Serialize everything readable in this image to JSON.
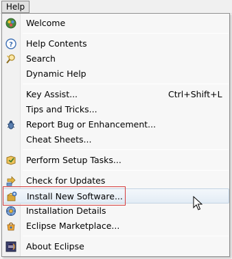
{
  "menubar": {
    "help_label": "Help"
  },
  "menu": {
    "items": [
      {
        "label": "Welcome",
        "icon": "welcome-icon"
      },
      {
        "label": "Help Contents",
        "icon": "help-contents-icon"
      },
      {
        "label": "Search",
        "icon": "search-icon"
      },
      {
        "label": "Dynamic Help"
      },
      {
        "label": "Key Assist...",
        "shortcut": "Ctrl+Shift+L"
      },
      {
        "label": "Tips and Tricks..."
      },
      {
        "label": "Report Bug or Enhancement...",
        "icon": "report-bug-icon"
      },
      {
        "label": "Cheat Sheets..."
      },
      {
        "label": "Perform Setup Tasks...",
        "icon": "setup-tasks-icon"
      },
      {
        "label": "Check for Updates",
        "icon": "check-updates-icon"
      },
      {
        "label": "Install New Software...",
        "icon": "install-software-icon"
      },
      {
        "label": "Installation Details",
        "icon": "installation-details-icon"
      },
      {
        "label": "Eclipse Marketplace...",
        "icon": "marketplace-icon"
      },
      {
        "label": "About Eclipse",
        "icon": "about-eclipse-icon"
      }
    ]
  },
  "colors": {
    "highlight_border": "#d43a3a",
    "hover_border": "#c2d3e3"
  }
}
